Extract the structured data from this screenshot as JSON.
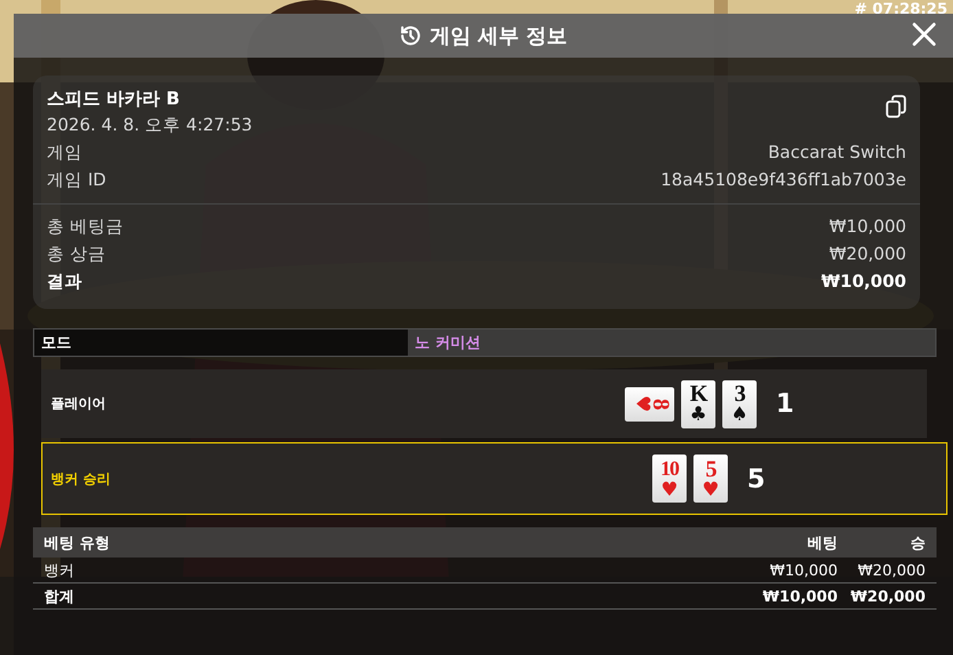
{
  "timestamp": "# 07:28:25",
  "header": {
    "title": "게임 세부 정보"
  },
  "summary": {
    "table_name": "스피드 바카라 B",
    "datetime": "2026. 4. 8. 오후 4:27:53",
    "details": [
      {
        "label": "게임",
        "value": "Baccarat Switch"
      },
      {
        "label": "게임 ID",
        "value": "18a45108e9f436ff1ab7003e"
      }
    ],
    "totals": [
      {
        "label": "총 베팅금",
        "value": "₩10,000",
        "bold": false
      },
      {
        "label": "총 상금",
        "value": "₩20,000",
        "bold": false
      },
      {
        "label": "결과",
        "value": "₩10,000",
        "bold": true
      }
    ]
  },
  "mode": {
    "label": "모드",
    "value": "노 커미션"
  },
  "hands": [
    {
      "label": "플레이어",
      "winner": false,
      "score": "1",
      "cards": [
        {
          "kind": "sideways",
          "rank": "8",
          "suit": "♥",
          "color": "#e02020"
        },
        {
          "kind": "upright",
          "rank": "K",
          "suit": "♣",
          "color": "#111111"
        },
        {
          "kind": "upright",
          "rank": "3",
          "suit": "♠",
          "color": "#111111"
        }
      ]
    },
    {
      "label": "뱅커 승리",
      "winner": true,
      "score": "5",
      "cards": [
        {
          "kind": "upright",
          "rank": "10",
          "suit": "♥",
          "color": "#e02020"
        },
        {
          "kind": "upright",
          "rank": "5",
          "suit": "♥",
          "color": "#e02020"
        }
      ]
    }
  ],
  "bets": {
    "columns": [
      "베팅 유형",
      "베팅",
      "승"
    ],
    "rows": [
      {
        "type": "뱅커",
        "bet": "₩10,000",
        "win": "₩20,000",
        "total": false
      },
      {
        "type": "합계",
        "bet": "₩10,000",
        "win": "₩20,000",
        "total": true
      }
    ]
  }
}
